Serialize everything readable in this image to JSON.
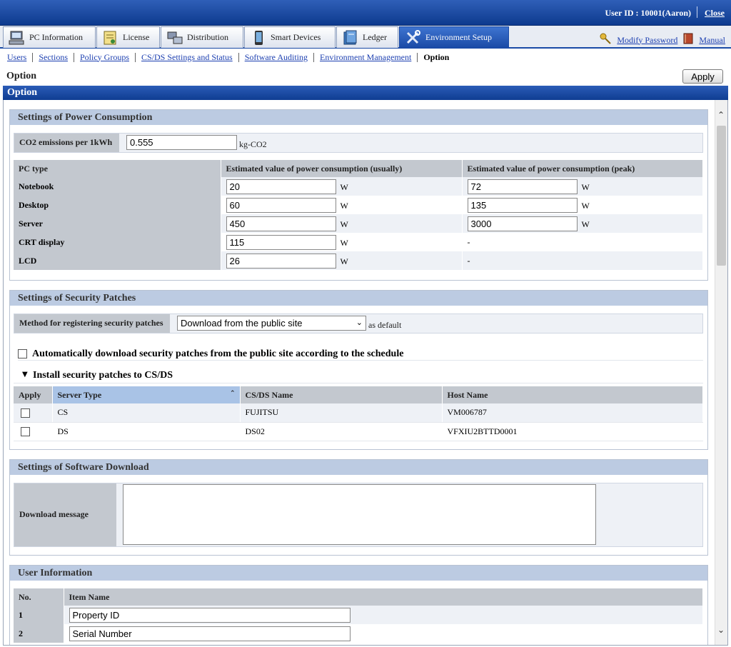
{
  "header": {
    "user_id": "User ID : 10001(Aaron)",
    "close": "Close"
  },
  "tabs": [
    {
      "label": "PC Information",
      "icon": "pc-icon"
    },
    {
      "label": "License",
      "icon": "license-icon"
    },
    {
      "label": "Distribution",
      "icon": "distribution-icon"
    },
    {
      "label": "Smart Devices",
      "icon": "smartphone-icon"
    },
    {
      "label": "Ledger",
      "icon": "ledger-icon"
    },
    {
      "label": "Environment Setup",
      "icon": "tools-icon"
    }
  ],
  "rightlinks": {
    "modify_password": "Modify Password",
    "manual": "Manual"
  },
  "subnav": [
    "Users",
    "Sections",
    "Policy Groups",
    "CS/DS Settings and Status",
    "Software Auditing",
    "Environment Management"
  ],
  "subnav_current": "Option",
  "page_title": "Option",
  "apply_label": "Apply",
  "option_bar": "Option",
  "power": {
    "title": "Settings of Power Consumption",
    "co2_label": "CO2 emissions per 1kWh",
    "co2_value": "0.555",
    "co2_unit": "kg-CO2",
    "col_type": "PC type",
    "col_usual": "Estimated value of power consumption (usually)",
    "col_peak": "Estimated value of power consumption (peak)",
    "unit": "W",
    "rows": [
      {
        "type": "Notebook",
        "usual": "20",
        "peak": "72"
      },
      {
        "type": "Desktop",
        "usual": "60",
        "peak": "135"
      },
      {
        "type": "Server",
        "usual": "450",
        "peak": "3000"
      },
      {
        "type": "CRT display",
        "usual": "115",
        "peak": "-"
      },
      {
        "type": "LCD",
        "usual": "26",
        "peak": "-"
      }
    ]
  },
  "security": {
    "title": "Settings of Security Patches",
    "method_label": "Method for registering security patches",
    "method_value": "Download from the public site",
    "as_default": "as default",
    "auto_download": "Automatically download security patches from the public site according to the schedule",
    "install_title": "Install security patches to CS/DS",
    "cols": {
      "apply": "Apply",
      "server_type": "Server Type",
      "name": "CS/DS Name",
      "host": "Host Name"
    },
    "rows": [
      {
        "type": "CS",
        "name": "FUJITSU",
        "host": "VM006787"
      },
      {
        "type": "DS",
        "name": "DS02",
        "host": "VFXIU2BTTD0001"
      }
    ]
  },
  "software": {
    "title": "Settings of Software Download",
    "download_label": "Download message",
    "download_value": ""
  },
  "userinfo": {
    "title": "User Information",
    "col_no": "No.",
    "col_item": "Item Name",
    "rows": [
      {
        "no": "1",
        "item": "Property ID"
      },
      {
        "no": "2",
        "item": "Serial Number"
      }
    ]
  }
}
